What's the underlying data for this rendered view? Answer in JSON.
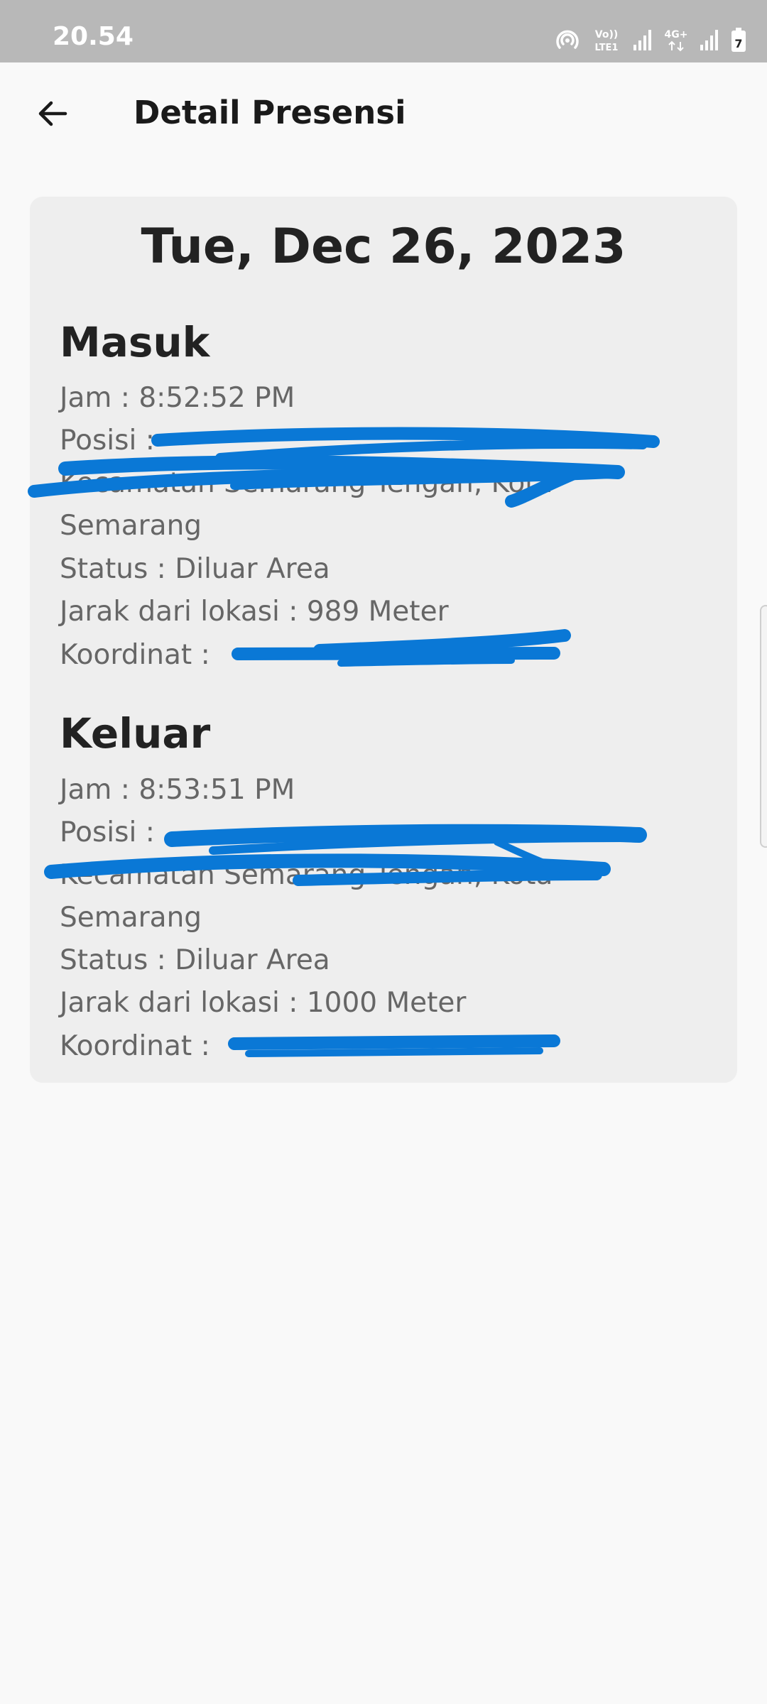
{
  "status_bar": {
    "time": "20.54",
    "network_label": "Vo)) LTE1",
    "network2_label": "4G+",
    "battery_label": "7"
  },
  "app_bar": {
    "back_icon": "arrow-left-icon",
    "title": "Detail Presensi"
  },
  "detail": {
    "date": "Tue, Dec 26, 2023",
    "masuk": {
      "title": "Masuk",
      "jam": "Jam : 8:52:52 PM",
      "posisi_label": "Posisi :",
      "posisi_line2": "Kecamatan Semarang Tengah, Kota",
      "posisi_line3": "Semarang",
      "status": "Status : Diluar Area",
      "jarak": "Jarak dari lokasi : 989 Meter",
      "koordinat_label": "Koordinat :"
    },
    "keluar": {
      "title": "Keluar",
      "jam": "Jam : 8:53:51 PM",
      "posisi_label": "Posisi :",
      "posisi_line2": "Kecamatan Semarang Tengah, Kota",
      "posisi_line3": "Semarang",
      "status": "Status : Diluar Area",
      "jarak": "Jarak dari lokasi : 1000 Meter",
      "koordinat_label": "Koordinat :"
    }
  },
  "colors": {
    "status_bar": "#b8b8b8",
    "background": "#f9f9f9",
    "card": "#eeeeee",
    "redaction": "#0a78d6"
  }
}
